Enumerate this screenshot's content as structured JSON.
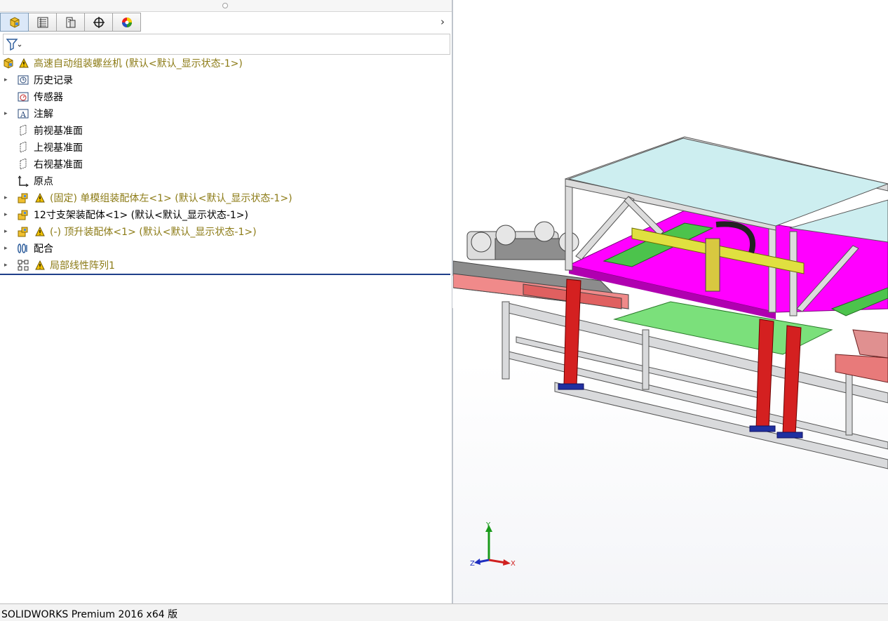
{
  "app": {
    "status_text": "SOLIDWORKS Premium 2016 x64 版"
  },
  "tabs": [
    {
      "name": "feature-manager-tab",
      "icon": "assembly-icon",
      "active": true
    },
    {
      "name": "property-manager-tab",
      "icon": "property-list-icon",
      "active": false
    },
    {
      "name": "configuration-manager-tab",
      "icon": "configuration-icon",
      "active": false
    },
    {
      "name": "dimxpert-manager-tab",
      "icon": "crosshair-icon",
      "active": false
    },
    {
      "name": "display-manager-tab",
      "icon": "color-wheel-icon",
      "active": false
    }
  ],
  "tree": {
    "root": {
      "label": "高速自动组装螺丝机  (默认<默认_显示状态-1>)",
      "warning": true
    },
    "items": [
      {
        "label": "历史记录",
        "icon": "history-icon",
        "expandable": true,
        "warning": false
      },
      {
        "label": "传感器",
        "icon": "sensor-icon",
        "expandable": false,
        "warning": false
      },
      {
        "label": "注解",
        "icon": "annotation-icon",
        "expandable": true,
        "warning": false
      },
      {
        "label": "前视基准面",
        "icon": "plane-icon",
        "expandable": false,
        "warning": false
      },
      {
        "label": "上视基准面",
        "icon": "plane-icon",
        "expandable": false,
        "warning": false
      },
      {
        "label": "右视基准面",
        "icon": "plane-icon",
        "expandable": false,
        "warning": false
      },
      {
        "label": "原点",
        "icon": "origin-icon",
        "expandable": false,
        "warning": false
      },
      {
        "label": "(固定) 单模组装配体左<1> (默认<默认_显示状态-1>)",
        "icon": "subassembly-icon",
        "expandable": true,
        "warning": true
      },
      {
        "label": "12寸支架装配体<1> (默认<默认_显示状态-1>)",
        "icon": "subassembly-icon",
        "expandable": true,
        "warning": false
      },
      {
        "label": "(-) 顶升装配体<1> (默认<默认_显示状态-1>)",
        "icon": "subassembly-icon",
        "expandable": true,
        "warning": true
      },
      {
        "label": "配合",
        "icon": "mates-icon",
        "expandable": true,
        "warning": false
      },
      {
        "label": "局部线性阵列1",
        "icon": "linear-pattern-icon",
        "expandable": true,
        "warning": true
      }
    ]
  },
  "triad": {
    "x": "X",
    "y": "Y",
    "z": "Z"
  },
  "colors": {
    "warning_text": "#8c7b16",
    "warning_icon": "#f2c200",
    "frame_red": "#d42020",
    "magenta": "#ff00ff",
    "green_plate": "#7be07b",
    "top_panel": "#cdeef0"
  }
}
